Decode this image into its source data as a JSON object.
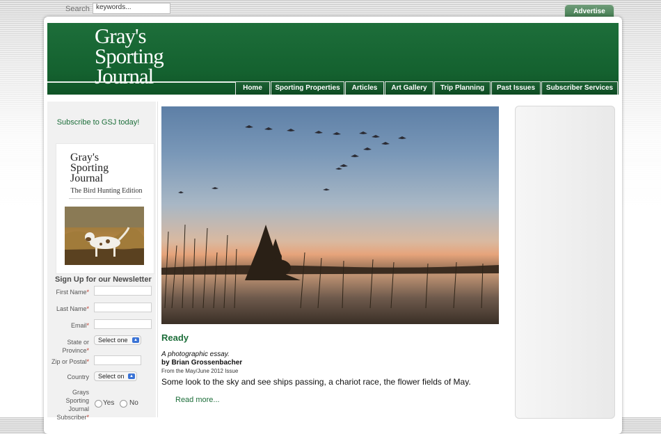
{
  "topbar": {
    "search_label": "Search",
    "search_value": "keywords...",
    "advertise_label": "Advertise"
  },
  "header": {
    "logo_lines": [
      "Gray's",
      "Sporting",
      "Journal"
    ],
    "nav": [
      {
        "label": "Home"
      },
      {
        "label": "Sporting Properties"
      },
      {
        "label": "Articles"
      },
      {
        "label": "Art Gallery"
      },
      {
        "label": "Trip Planning"
      },
      {
        "label": "Past Issues"
      },
      {
        "label": "Subscriber Services"
      }
    ]
  },
  "sidebar": {
    "subscribe_text": "Subscribe to GSJ today!",
    "cover": {
      "title_lines": [
        "Gray's",
        "Sporting",
        "Journal"
      ],
      "subtitle": "The Bird Hunting Edition"
    },
    "newsletter": {
      "title": "Sign Up for our Newsletter",
      "first_name_label": "First Name",
      "last_name_label": "Last Name",
      "email_label": "Email",
      "state_label_1": "State or",
      "state_label_2": "Province",
      "state_value": "Select one",
      "zip_label": "Zip or Postal",
      "country_label": "Country",
      "country_value": "Select on",
      "subscriber_label_1": "Grays",
      "subscriber_label_2": "Sporting",
      "subscriber_label_3": "Journal",
      "subscriber_label_4": "Subscriber",
      "yes_label": "Yes",
      "no_label": "No",
      "required_mark": "*"
    }
  },
  "article": {
    "title": "Ready",
    "deck": "A photographic essay.",
    "byline": "by Brian Grossenbacher",
    "issue": "From the May/June 2012 Issue",
    "excerpt": "Some look to the sky and see ships passing, a chariot race, the flower fields of May.",
    "read_more": "Read more..."
  },
  "colors": {
    "brand_green": "#1d6e3a",
    "nav_bg": "#0d4a22",
    "required": "#c0392b"
  }
}
